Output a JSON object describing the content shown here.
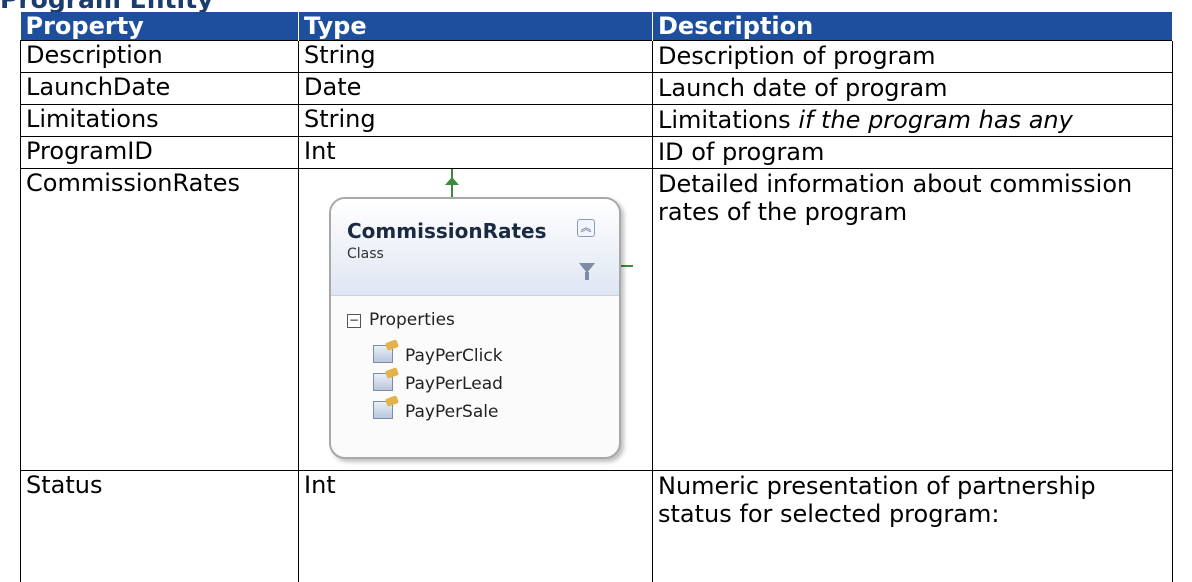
{
  "heading": "Program Entity",
  "columns": [
    "Property",
    "Type",
    "Description"
  ],
  "rows": [
    {
      "property": "Description",
      "type": "String",
      "description": "Description of program"
    },
    {
      "property": "LaunchDate",
      "type": "Date",
      "description": "Launch date of program"
    },
    {
      "property": "Limitations",
      "type": "String",
      "description_plain": "Limitations ",
      "description_italic": "if the program has any"
    },
    {
      "property": "ProgramID",
      "type": "Int",
      "description": "ID of program"
    },
    {
      "property": "CommissionRates",
      "description": "Detailed information about commission rates of the program"
    },
    {
      "property": "Status",
      "type": "Int",
      "description": "Numeric presentation of partnership status for selected program:"
    }
  ],
  "diagram": {
    "class_name": "CommissionRates",
    "stereotype": "Class",
    "section": "Properties",
    "properties": [
      "PayPerClick",
      "PayPerLead",
      "PayPerSale"
    ]
  },
  "colors": {
    "header_bg": "#1e4f9c",
    "header_text": "#ffffff",
    "connector": "#3d8a3d"
  }
}
